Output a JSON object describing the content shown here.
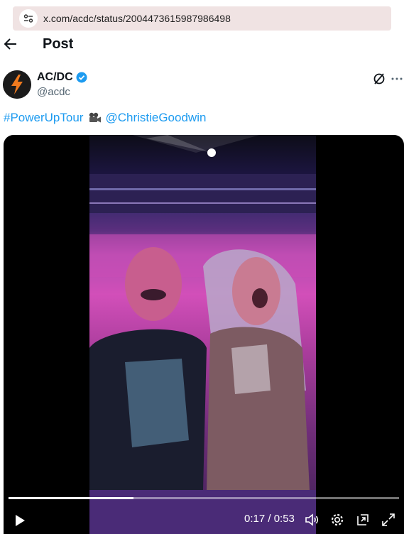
{
  "browser": {
    "url": "x.com/acdc/status/2004473615987986498"
  },
  "header": {
    "title": "Post"
  },
  "post": {
    "author": {
      "display_name": "AC/DC",
      "handle": "@acdc",
      "verified": true
    },
    "text": {
      "hashtag": "#PowerUpTour",
      "emoji": "movie-camera-icon",
      "mention": "@ChristieGoodwin"
    }
  },
  "video": {
    "current_time": "0:17",
    "duration": "0:53",
    "time_display": "0:17 / 0:53",
    "progress_fraction": 0.32
  },
  "colors": {
    "link": "#1d9bf0",
    "verified": "#1d9bf0",
    "secondary_text": "#536471",
    "urlbar_bg": "#f0e3e3"
  }
}
